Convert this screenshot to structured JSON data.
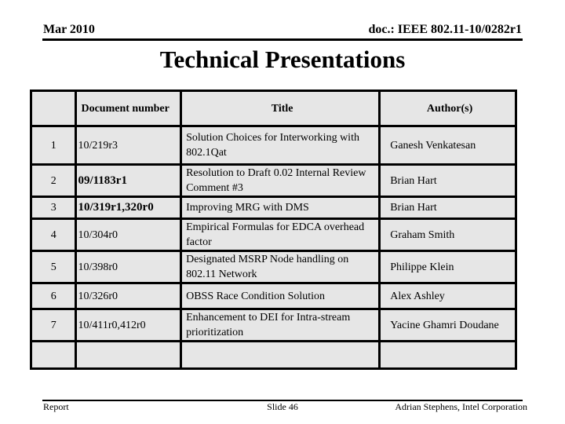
{
  "header": {
    "date": "Mar 2010",
    "doc_id": "doc.: IEEE 802.11-10/0282r1"
  },
  "slide_title": "Technical Presentations",
  "table": {
    "columns": [
      "",
      "Document number",
      "Title",
      "Author(s)"
    ],
    "rows": [
      {
        "num": "1",
        "doc": "10/219r3",
        "title": "Solution Choices for Interworking with 802.1Qat",
        "author": "Ganesh Venkatesan"
      },
      {
        "num": "2",
        "doc": "09/1183r1",
        "title": "Resolution to Draft 0.02 Internal Review  Comment #3",
        "author": "Brian Hart"
      },
      {
        "num": "3",
        "doc": "10/319r1,320r0",
        "title": "Improving MRG with DMS",
        "author": "Brian Hart"
      },
      {
        "num": "4",
        "doc": "10/304r0",
        "title": "Empirical Formulas for EDCA overhead factor",
        "author": "Graham Smith"
      },
      {
        "num": "5",
        "doc": "10/398r0",
        "title": "Designated MSRP Node handling on 802.11 Network",
        "author": "Philippe Klein"
      },
      {
        "num": "6",
        "doc": "10/326r0",
        "title": "OBSS Race Condition Solution",
        "author": "Alex Ashley"
      },
      {
        "num": "7",
        "doc": "10/411r0,412r0",
        "title": "Enhancement to DEI for Intra-stream prioritization",
        "author": "Yacine Ghamri Doudane"
      },
      {
        "num": "",
        "doc": "",
        "title": "",
        "author": ""
      }
    ]
  },
  "footer": {
    "left": "Report",
    "center": "Slide 46",
    "right": "Adrian Stephens, Intel Corporation"
  }
}
